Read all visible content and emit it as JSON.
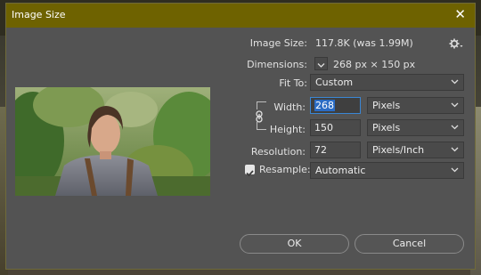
{
  "dialog": {
    "title": "Image Size",
    "close_glyph": "✕"
  },
  "info": {
    "image_size_label": "Image Size:",
    "image_size_value": "117.8K (was 1.99M)",
    "dimensions_label": "Dimensions:",
    "dimensions_value": "268 px  ×  150 px"
  },
  "fit_to": {
    "label": "Fit To:",
    "value": "Custom"
  },
  "width": {
    "label": "Width:",
    "value": "268",
    "unit": "Pixels"
  },
  "height": {
    "label": "Height:",
    "value": "150",
    "unit": "Pixels"
  },
  "resolution": {
    "label": "Resolution:",
    "value": "72",
    "unit": "Pixels/Inch"
  },
  "resample": {
    "label": "Resample:",
    "checked": true,
    "value": "Automatic"
  },
  "buttons": {
    "ok": "OK",
    "cancel": "Cancel"
  },
  "colors": {
    "titlebar": "#6e6200",
    "dialog_bg": "#535353",
    "focus_blue": "#3a86d4"
  },
  "icons": [
    "gear-icon",
    "close-icon",
    "chevron-down-icon",
    "link-chain-icon",
    "checkmark-icon"
  ]
}
